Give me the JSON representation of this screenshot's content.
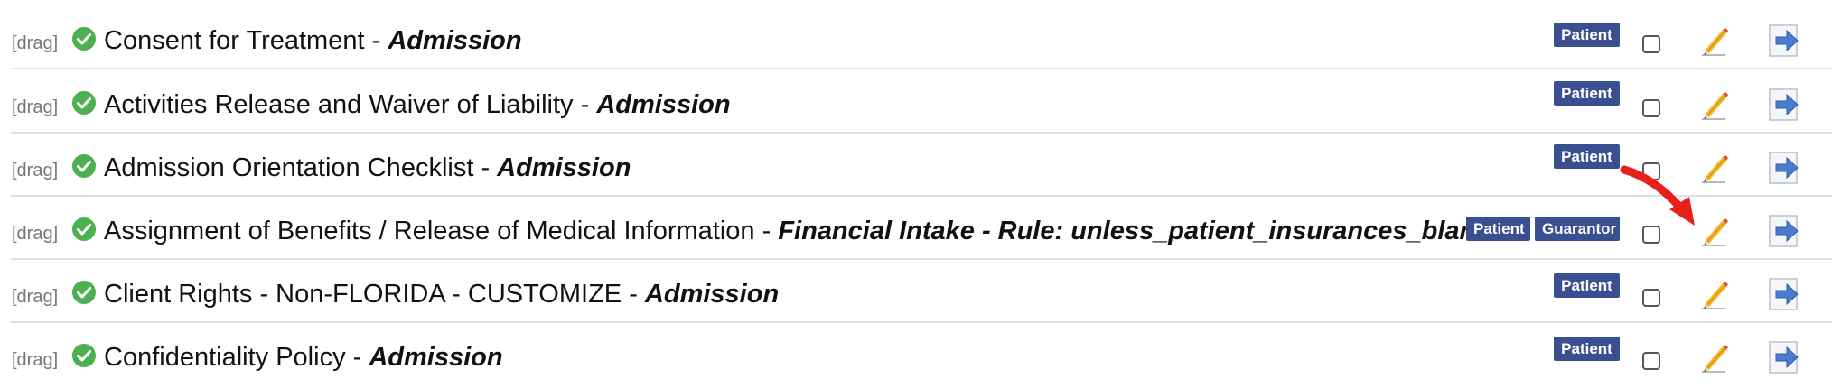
{
  "rows": [
    {
      "drag": "[drag]",
      "name": "Consent for Treatment",
      "sep": " - ",
      "category": "Admission",
      "badges": [
        "Patient"
      ]
    },
    {
      "drag": "[drag]",
      "name": "Activities Release and Waiver of Liability",
      "sep": " - ",
      "category": "Admission",
      "badges": [
        "Patient"
      ]
    },
    {
      "drag": "[drag]",
      "name": "Admission Orientation Checklist",
      "sep": " - ",
      "category": "Admission",
      "badges": [
        "Patient"
      ]
    },
    {
      "drag": "[drag]",
      "name": "Assignment of Benefits / Release of Medical Information",
      "sep": " - ",
      "category": "Financial Intake - Rule: unless_patient_insurances_blank",
      "badges": [
        "Patient",
        "Guarantor"
      ]
    },
    {
      "drag": "[drag]",
      "name": "Client Rights - Non-FLORIDA - CUSTOMIZE",
      "sep": " - ",
      "category": "Admission",
      "badges": [
        "Patient"
      ]
    },
    {
      "drag": "[drag]",
      "name": "Confidentiality Policy",
      "sep": " - ",
      "category": "Admission",
      "badges": [
        "Patient"
      ]
    }
  ],
  "icons": {
    "status": "check-circle-icon",
    "edit": "pencil-icon",
    "go": "arrow-right-icon",
    "annotation": "red-arrow-icon"
  },
  "colors": {
    "badge": "#3a4f8f",
    "check": "#4caf50",
    "divider": "#d6e3ef",
    "annotation": "#e8201a"
  }
}
